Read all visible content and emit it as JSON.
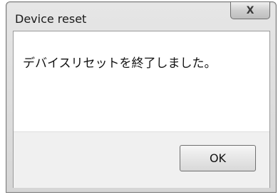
{
  "window": {
    "title": "Device reset",
    "close_glyph": "X",
    "message": "デバイスリセットを終了しました。",
    "ok_label": "OK"
  }
}
